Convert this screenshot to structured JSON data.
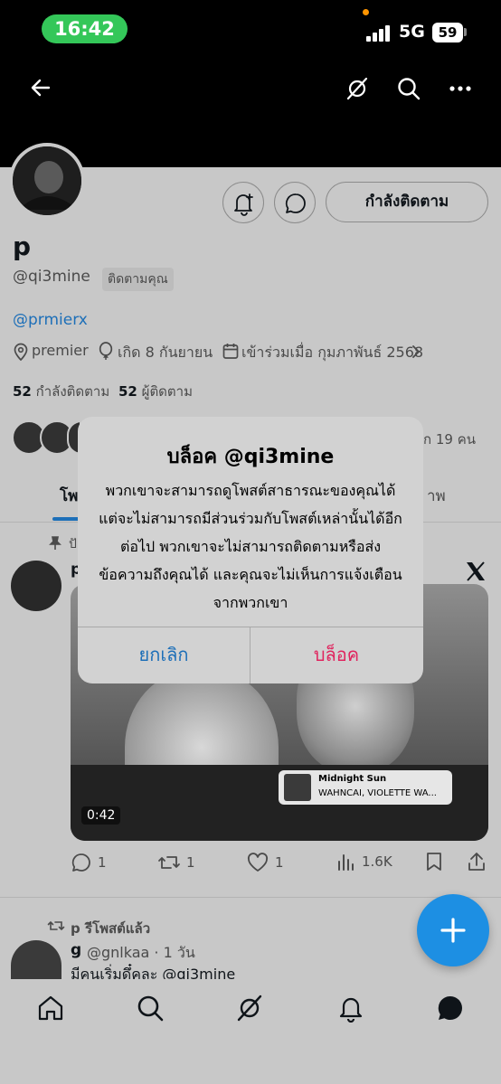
{
  "status_bar": {
    "time": "16:42",
    "network": "5G",
    "battery": "59"
  },
  "header": {
    "back_icon": "back-arrow-icon",
    "grok_icon": "grok-icon",
    "search_icon": "search-icon",
    "more_icon": "more-icon"
  },
  "profile": {
    "follow_button": "กำลังติดตาม",
    "name": "p",
    "handle": "@qi3mine",
    "follows_you": "ติดตามคุณ",
    "bio_link": "@prmierx",
    "location": "premier",
    "birthday": "เกิด 8 กันยายน",
    "joined": "เข้าร่วมเมื่อ กุมภาพันธ์ 2568",
    "following_count": "52",
    "following_label": "กำลังติดตาม",
    "followers_count": "52",
    "followers_label": "ผู้ติดตาม",
    "mutual_suffix": "ก 19 คน"
  },
  "tabs": {
    "first_partial": "โพ",
    "last_partial": "าพ"
  },
  "pinned_partial": "ปั",
  "post": {
    "author_partial": "p",
    "music_title": "Midnight Sun",
    "music_artist": "WAHNCAI, VIOLETTE WA...",
    "duration": "0:42",
    "replies": "1",
    "reposts": "1",
    "likes": "1",
    "views": "1.6K"
  },
  "repost": {
    "reposted_by": "p รีโพสต์แล้ว",
    "author": "g",
    "handle_time": "@gnlkaa · 1 วัน",
    "text_partial": "มีคนเริ่มดึ๋คละ @qi3mine"
  },
  "dialog": {
    "title": "บล็อค @qi3mine",
    "body": "พวกเขาจะสามารถดูโพสต์สาธารณะของคุณได้ แต่จะไม่สามารถมีส่วนร่วมกับโพสต์เหล่านั้นได้อีกต่อไป พวกเขาจะไม่สามารถติดตามหรือส่งข้อความถึงคุณได้ และคุณจะไม่เห็นการแจ้งเตือนจากพวกเขา",
    "cancel": "ยกเลิก",
    "block": "บล็อค"
  },
  "colors": {
    "accent": "#1d6fb8",
    "destructive": "#e0245e",
    "fab": "#1d8fe3",
    "status_pill": "#34c759"
  }
}
